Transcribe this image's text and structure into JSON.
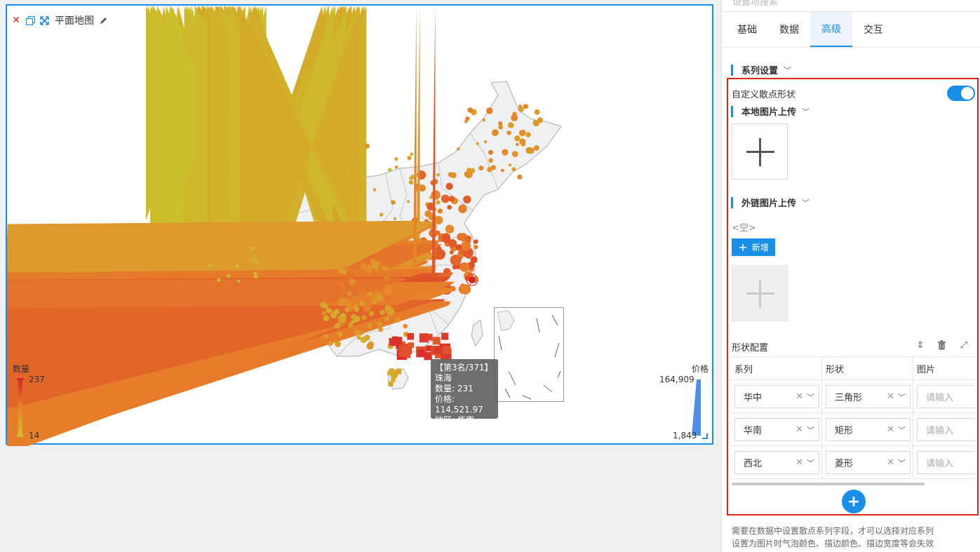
{
  "card": {
    "title": "平面地图"
  },
  "legend_left": {
    "title": "数量",
    "max": "237",
    "min": "14"
  },
  "legend_right": {
    "title": "价格",
    "max": "164,909",
    "min": "1,843"
  },
  "tooltip": {
    "rank": "【第3名/371】",
    "city": "珠海",
    "count": "数量: 231",
    "price": "价格: 114,521.97",
    "region": "地区: 华南"
  },
  "panel": {
    "search_placeholder": "设置项搜索",
    "tabs": [
      "基础",
      "数据",
      "高级",
      "交互"
    ],
    "series_section": "系列设置",
    "custom_shape_label": "自定义散点形状",
    "local_upload_section": "本地图片上传",
    "external_upload_section": "外链图片上传",
    "empty_text": "<空>",
    "add_label": "新增",
    "shape_config_label": "形状配置",
    "table": {
      "headers": [
        "系列",
        "形状",
        "图片"
      ],
      "rows": [
        {
          "series": "华中",
          "shape": "三角形",
          "image_placeholder": "请输入"
        },
        {
          "series": "华南",
          "shape": "矩形",
          "image_placeholder": "请输入"
        },
        {
          "series": "西北",
          "shape": "菱形",
          "image_placeholder": "请输入"
        }
      ]
    },
    "notes": [
      "需要在数据中设置散点系列字段，才可以选择对应系列",
      "设置为图片时气泡颜色、描边颜色、描边宽度等会失效"
    ]
  },
  "colors": {
    "accent": "#1a8fe8",
    "highlight": "#e1251b",
    "high": "#d8262a",
    "mid": "#e7842a",
    "low": "#c9c12a"
  }
}
